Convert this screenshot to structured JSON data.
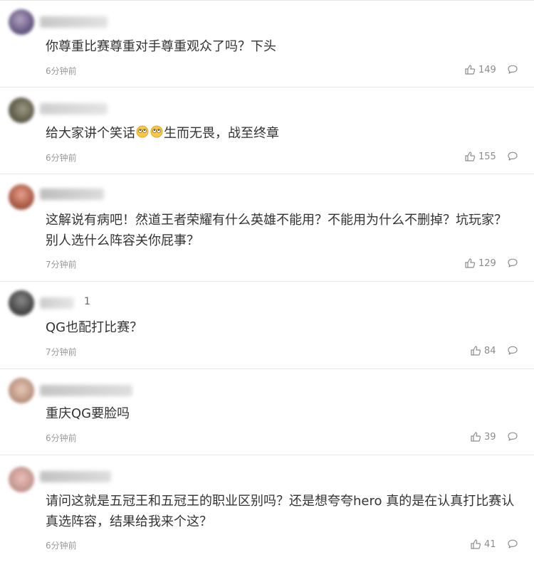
{
  "comments": [
    {
      "username_suffix": "",
      "text": "你尊重比赛尊重对手尊重观众了吗？下头",
      "time": "6分钟前",
      "likes": "149"
    },
    {
      "username_suffix": "",
      "text_before_emoji": "给大家讲个笑话",
      "text_after_emoji": "生而无畏，战至终章",
      "emoji_icon": "rolling-eyes-emoji-icon",
      "time": "6分钟前",
      "likes": "155"
    },
    {
      "username_suffix": "",
      "text": "这解说有病吧！然道王者荣耀有什么英雄不能用？不能用为什么不删掉？坑玩家？别人选什么阵容关你屁事？",
      "time": "7分钟前",
      "likes": "129"
    },
    {
      "username_suffix": "1",
      "text": "QG也配打比赛？",
      "time": "7分钟前",
      "likes": "84"
    },
    {
      "username_suffix": "",
      "text": "重庆QG要脸吗",
      "time": "6分钟前",
      "likes": "39"
    },
    {
      "username_suffix": "",
      "text": "请问这就是五冠王和五冠王的职业区别吗？还是想夸夸hero 真的是在认真打比赛认真选阵容，结果给我来个这？",
      "time": "6分钟前",
      "likes": "41"
    }
  ]
}
